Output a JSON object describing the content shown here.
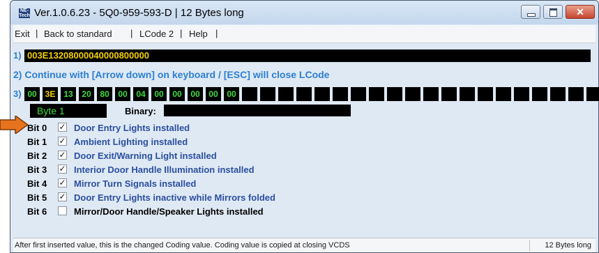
{
  "window": {
    "title": "Ver.1.0.6.23 -  5Q0-959-593-D | 12 Bytes long",
    "app_icon_text": "NE-Tech"
  },
  "menu": [
    {
      "label": "Exit"
    },
    {
      "label": "Back to standard"
    },
    {
      "label": "LCode 2"
    },
    {
      "label": "Help"
    }
  ],
  "menu_separator": "|",
  "row1": {
    "label": "1)",
    "code": "003E13208000040000800000"
  },
  "row2": {
    "text": "2) Continue with [Arrow down] on keyboard / [ESC] will close LCode"
  },
  "row3": {
    "label": "3)",
    "bytes": [
      "00",
      "3E",
      "13",
      "20",
      "80",
      "00",
      "04",
      "00",
      "00",
      "00",
      "00",
      "00"
    ],
    "active_index": 1,
    "empty_cells": 21
  },
  "byte_panel": {
    "byte_label": "Byte 1",
    "binary_label": "Binary:",
    "binary_value": ""
  },
  "bits": [
    {
      "label": "Bit 0",
      "checked": true,
      "desc": "Door Entry Lights installed"
    },
    {
      "label": "Bit 1",
      "checked": true,
      "desc": "Ambient Lighting installed"
    },
    {
      "label": "Bit 2",
      "checked": true,
      "desc": "Door Exit/Warning Light installed"
    },
    {
      "label": "Bit 3",
      "checked": true,
      "desc": "Interior Door Handle Illumination installed"
    },
    {
      "label": "Bit 4",
      "checked": true,
      "desc": "Mirror Turn Signals installed"
    },
    {
      "label": "Bit 5",
      "checked": true,
      "desc": "Door Entry Lights inactive while Mirrors folded"
    },
    {
      "label": "Bit 6",
      "checked": false,
      "desc": "Mirror/Door Handle/Speaker Lights installed"
    }
  ],
  "status": {
    "main": "After first inserted value, this is the changed Coding value.  Coding value is copied at closing VCDS",
    "right": "12 Bytes long"
  },
  "colors": {
    "checked_desc": "#2a4f9e",
    "unchecked_desc": "#000000",
    "byte_text": "#3fdc3f",
    "active_byte_text": "#f5d100",
    "arrow": "#e8731f"
  },
  "icons": {
    "minimize": "minimize-icon",
    "maximize": "maximize-icon",
    "close": "close-icon",
    "check": "checkmark-icon",
    "pointer": "arrow-pointer-icon"
  }
}
